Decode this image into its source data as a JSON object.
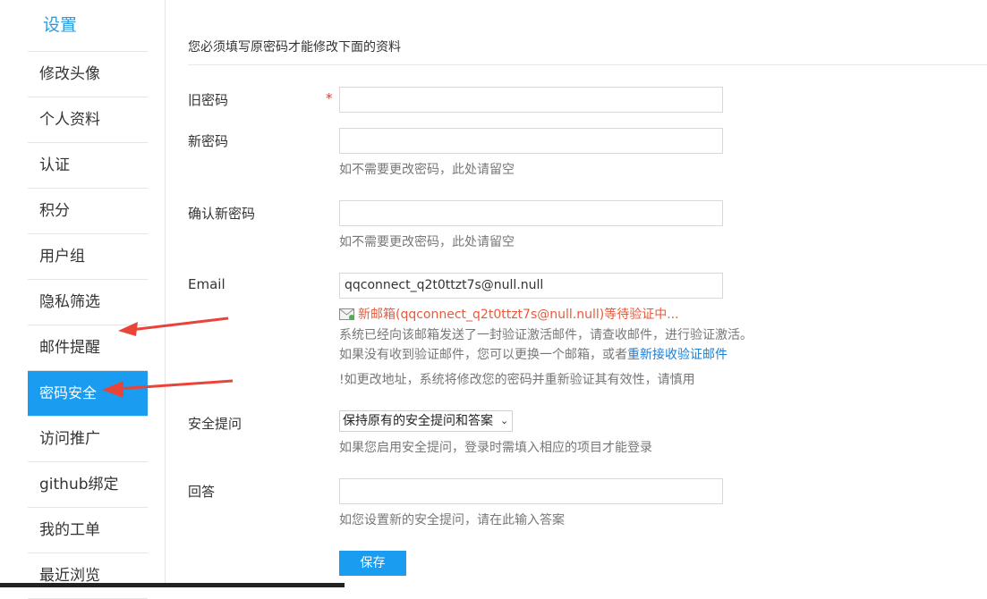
{
  "sidebar": {
    "title": "设置",
    "items": [
      {
        "label": "修改头像"
      },
      {
        "label": "个人资料"
      },
      {
        "label": "认证"
      },
      {
        "label": "积分"
      },
      {
        "label": "用户组"
      },
      {
        "label": "隐私筛选"
      },
      {
        "label": "邮件提醒"
      },
      {
        "label": "密码安全",
        "active": true
      },
      {
        "label": "访问推广"
      },
      {
        "label": "github绑定"
      },
      {
        "label": "我的工单"
      },
      {
        "label": "最近浏览"
      }
    ]
  },
  "form": {
    "notice": "您必须填写原密码才能修改下面的资料",
    "old_password": {
      "label": "旧密码",
      "required_mark": "*",
      "value": ""
    },
    "new_password": {
      "label": "新密码",
      "value": "",
      "hint": "如不需要更改密码，此处请留空"
    },
    "confirm_password": {
      "label": "确认新密码",
      "value": "",
      "hint": "如不需要更改密码，此处请留空"
    },
    "email": {
      "label": "Email",
      "value": "qqconnect_q2t0ttzt7s@null.null",
      "pending": "新邮箱(qqconnect_q2t0ttzt7s@null.null)等待验证中...",
      "sent_text": "系统已经向该邮箱发送了一封验证激活邮件，请查收邮件，进行验证激活。",
      "resend_prefix": "如果没有收到验证邮件，您可以更换一个邮箱，或者",
      "resend_link": "重新接收验证邮件",
      "warning": "!如更改地址，系统将修改您的密码并重新验证其有效性，请慎用"
    },
    "security_question": {
      "label": "安全提问",
      "selected": "保持原有的安全提问和答案",
      "hint": "如果您启用安全提问，登录时需填入相应的项目才能登录"
    },
    "answer": {
      "label": "回答",
      "value": "",
      "hint": "如您设置新的安全提问，请在此输入答案"
    },
    "save_label": "保存"
  },
  "colors": {
    "accent": "#1a9cf0",
    "title": "#2a9be0",
    "arrow": "#e8443a",
    "pending": "#e85a3c"
  }
}
